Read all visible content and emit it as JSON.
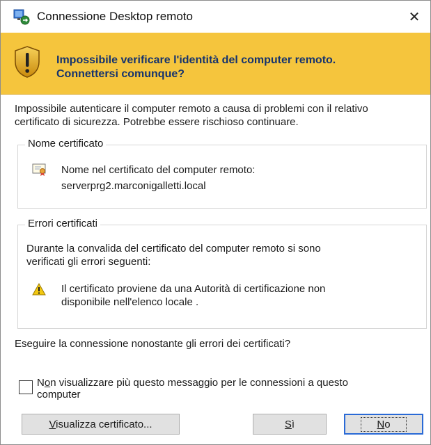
{
  "window": {
    "title": "Connessione Desktop remoto",
    "close_symbol": "✕"
  },
  "banner": {
    "line1": "Impossibile verificare l'identità del computer remoto.",
    "line2": "Connettersi comunque?",
    "background_color": "#f5c53d",
    "text_color": "#15336e"
  },
  "message": {
    "line1": "Impossibile autenticare il computer remoto a causa di problemi con il relativo",
    "line2": "certificato di sicurezza. Potrebbe essere rischioso continuare."
  },
  "certificate_group": {
    "legend": "Nome certificato",
    "label": "Nome nel certificato del computer remoto:",
    "value": "serverprg2.marconigalletti.local"
  },
  "errors_group": {
    "legend": "Errori certificati",
    "intro_line1": "Durante la convalida del certificato del computer remoto si sono",
    "intro_line2": "verificati gli errori seguenti:",
    "items": [
      {
        "line1": "Il certificato proviene da una Autorità di certificazione non",
        "line2": "disponibile nell'elenco locale ."
      }
    ]
  },
  "question": "Eseguire la connessione nonostante gli errori dei certificati?",
  "checkbox": {
    "checked": false,
    "label_first": "N",
    "label_underlined": "o",
    "label_rest": "n visualizzare più questo messaggio per le connessioni a questo",
    "label_line2": "computer"
  },
  "buttons": {
    "view_cert_underlined": "V",
    "view_cert_rest": "isualizza certificato...",
    "yes_underlined": "S",
    "yes_rest": "ì",
    "no_underlined": "N",
    "no_rest": "o"
  }
}
